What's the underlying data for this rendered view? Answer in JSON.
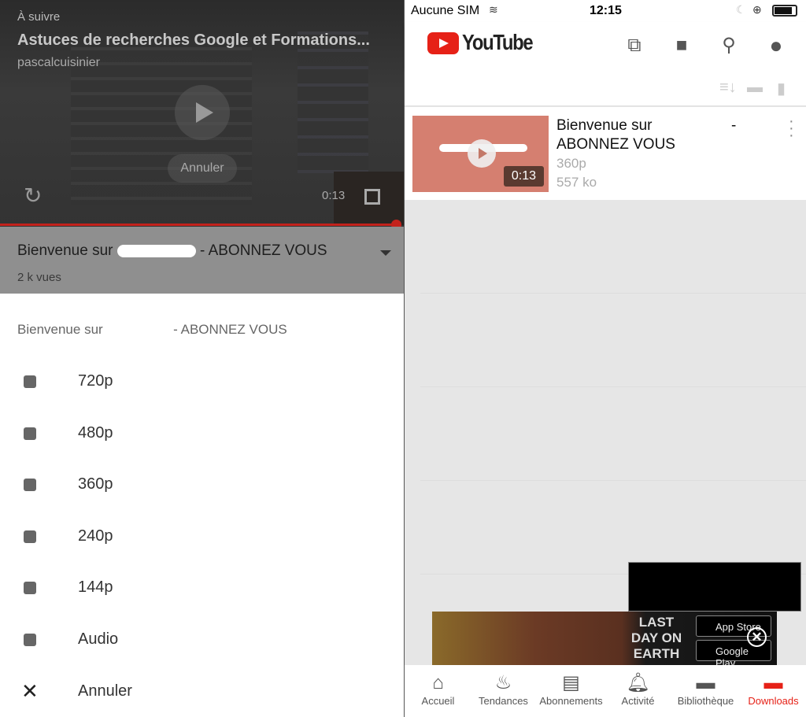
{
  "left": {
    "up_next_label": "À suivre",
    "up_next_title": "Astuces de recherches Google et Formations...",
    "up_next_channel": "pascalcuisinier",
    "cancel_autoplay": "Annuler",
    "video_time": "0:13",
    "progress": 0.99,
    "video_title_prefix": "Bienvenue sur",
    "video_title_suffix": "- ABONNEZ VOUS",
    "views": "2 k vues",
    "sheet": {
      "title_prefix": "Bienvenue sur",
      "title_suffix": "- ABONNEZ VOUS",
      "options": [
        "720p",
        "480p",
        "360p",
        "240p",
        "144p",
        "Audio"
      ],
      "cancel": "Annuler"
    }
  },
  "right": {
    "status": {
      "carrier": "Aucune SIM",
      "time": "12:15"
    },
    "logo": "YouTube",
    "item": {
      "title_prefix": "Bienvenue sur",
      "title_suffix": "- ABONNEZ VOUS",
      "duration": "0:13",
      "quality": "360p",
      "size": "557 ko"
    },
    "ad": {
      "brand": "LAST DAY ON EARTH",
      "app_store": "App Store",
      "google_play": "Google Play"
    },
    "nav": [
      {
        "label": "Accueil",
        "icon": "home-icon"
      },
      {
        "label": "Tendances",
        "icon": "flame-icon"
      },
      {
        "label": "Abonnements",
        "icon": "subscriptions-icon"
      },
      {
        "label": "Activité",
        "icon": "bell-icon"
      },
      {
        "label": "Bibliothèque",
        "icon": "folder-icon"
      },
      {
        "label": "Downloads",
        "icon": "folder-icon",
        "active": true
      }
    ],
    "accent": "#e62117"
  }
}
